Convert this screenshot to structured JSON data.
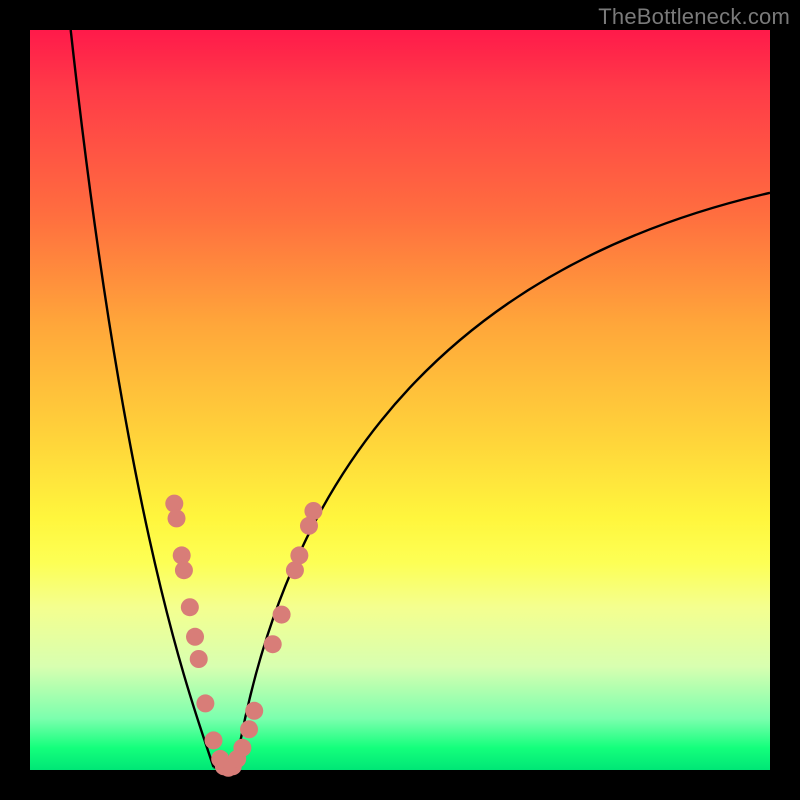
{
  "watermark": "TheBottleneck.com",
  "chart_data": {
    "type": "line",
    "title": "",
    "xlabel": "",
    "ylabel": "",
    "xlim": [
      0,
      100
    ],
    "ylim": [
      0,
      100
    ],
    "curve": {
      "description": "V-shaped bottleneck curve with minimum near x≈26; left branch reaches 100 at x≈5, right branch approaches ~78 at x=100",
      "min_x": 26,
      "min_y": 0,
      "left_top": {
        "x": 5.5,
        "y": 100
      },
      "right_end": {
        "x": 100,
        "y": 78
      }
    },
    "markers_left": [
      {
        "x": 19.5,
        "y": 36
      },
      {
        "x": 19.8,
        "y": 34
      },
      {
        "x": 20.5,
        "y": 29
      },
      {
        "x": 20.8,
        "y": 27
      },
      {
        "x": 21.6,
        "y": 22
      },
      {
        "x": 22.3,
        "y": 18
      },
      {
        "x": 22.8,
        "y": 15
      },
      {
        "x": 23.7,
        "y": 9
      },
      {
        "x": 24.8,
        "y": 4
      },
      {
        "x": 25.7,
        "y": 1.5
      }
    ],
    "markers_right": [
      {
        "x": 28.0,
        "y": 1.5
      },
      {
        "x": 28.7,
        "y": 3
      },
      {
        "x": 29.6,
        "y": 5.5
      },
      {
        "x": 30.3,
        "y": 8
      },
      {
        "x": 32.8,
        "y": 17
      },
      {
        "x": 34.0,
        "y": 21
      },
      {
        "x": 35.8,
        "y": 27
      },
      {
        "x": 36.4,
        "y": 29
      },
      {
        "x": 37.7,
        "y": 33
      },
      {
        "x": 38.3,
        "y": 35
      }
    ],
    "markers_bottom": [
      {
        "x": 26.2,
        "y": 0.5
      },
      {
        "x": 26.8,
        "y": 0.3
      },
      {
        "x": 27.4,
        "y": 0.5
      }
    ],
    "marker_color": "#d87d78",
    "marker_radius": 9
  }
}
